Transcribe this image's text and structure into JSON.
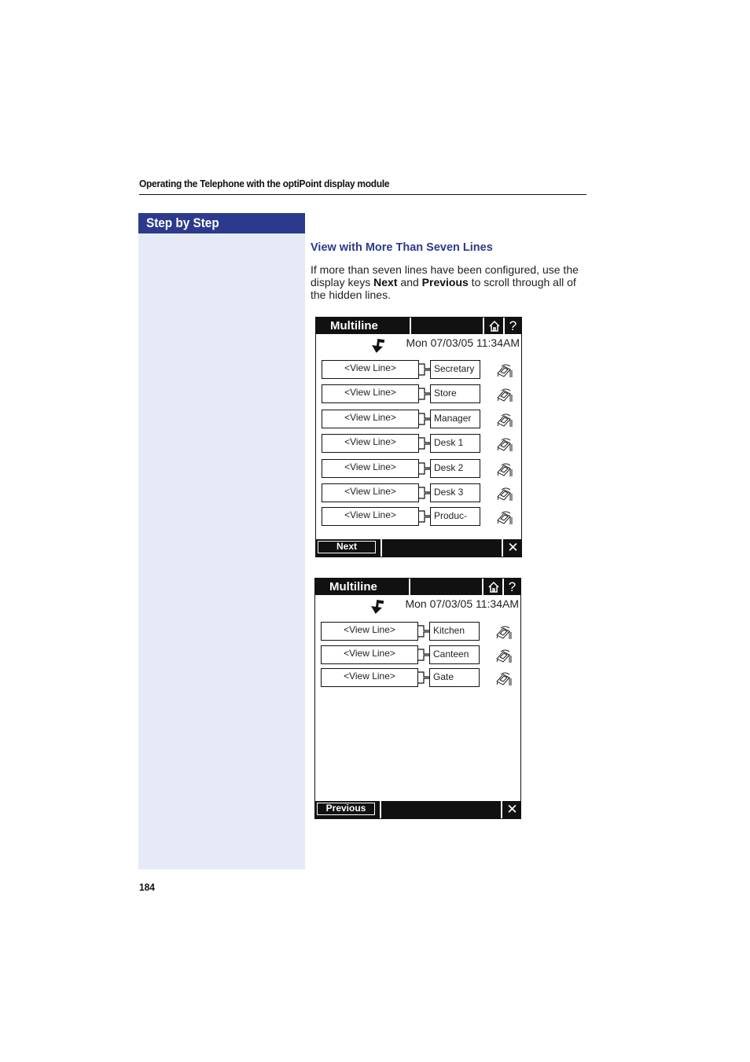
{
  "running_header": "Operating the Telephone with the optiPoint display module",
  "sidebar": {
    "title": "Step by Step"
  },
  "section": {
    "title": "View with More Than Seven Lines",
    "body_pre": "If more than seven lines have been configured, use the display keys ",
    "key_next": "Next",
    "body_mid": " and ",
    "key_previous": "Previous",
    "body_post": " to scroll through all of the hidden lines."
  },
  "screens": [
    {
      "title": "Multiline",
      "home_icon": "home-icon",
      "help_label": "?",
      "datetime": "Mon 07/03/05 11:34AM",
      "rows": [
        {
          "view_label": "<View Line>",
          "name": "Secretary"
        },
        {
          "view_label": "<View Line>",
          "name": "Store"
        },
        {
          "view_label": "<View Line>",
          "name": "Manager"
        },
        {
          "view_label": "<View Line>",
          "name": "Desk 1"
        },
        {
          "view_label": "<View Line>",
          "name": "Desk 2"
        },
        {
          "view_label": "<View Line>",
          "name": "Desk 3"
        },
        {
          "view_label": "<View Line>",
          "name": "Produc-"
        }
      ],
      "softkey": "Next",
      "close_label": "✕"
    },
    {
      "title": "Multiline",
      "home_icon": "home-icon",
      "help_label": "?",
      "datetime": "Mon 07/03/05 11:34AM",
      "rows": [
        {
          "view_label": "<View Line>",
          "name": "Kitchen"
        },
        {
          "view_label": "<View Line>",
          "name": "Canteen"
        },
        {
          "view_label": "<View Line>",
          "name": "Gate"
        }
      ],
      "softkey": "Previous",
      "close_label": "✕"
    }
  ],
  "page_number": "184"
}
